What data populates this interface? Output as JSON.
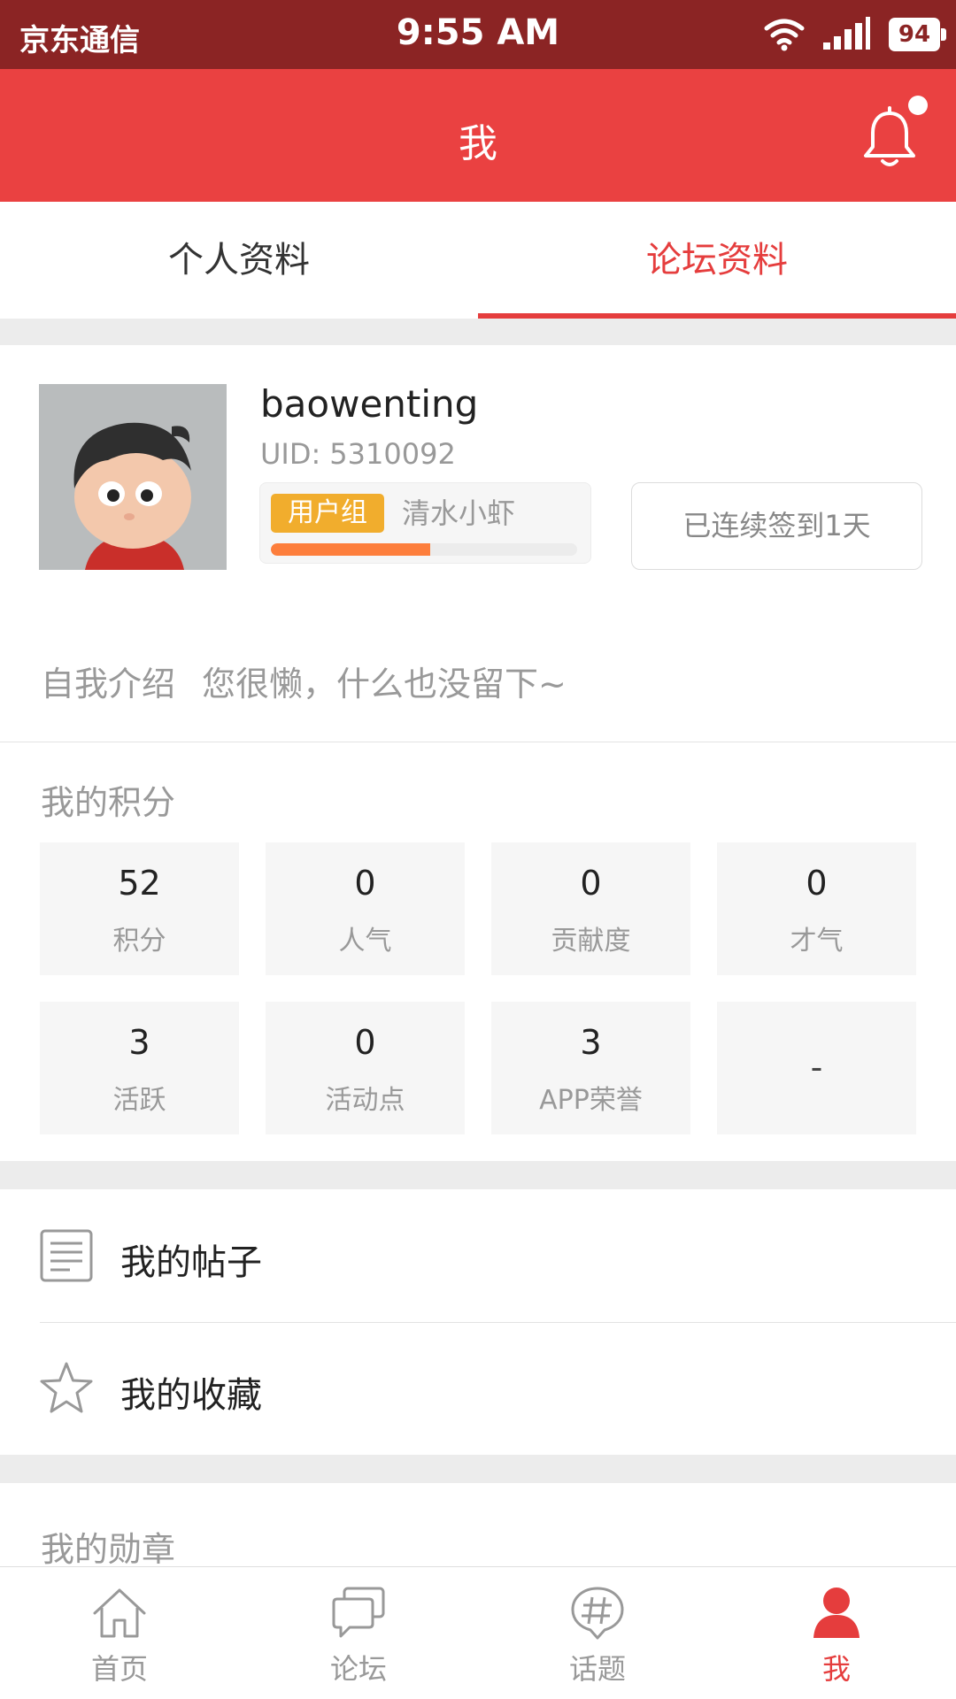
{
  "status_bar": {
    "carrier": "京东通信",
    "time": "9:55 AM",
    "battery": "94"
  },
  "header": {
    "title": "我"
  },
  "tabs": [
    {
      "label": "个人资料",
      "active": false
    },
    {
      "label": "论坛资料",
      "active": true
    }
  ],
  "profile": {
    "username": "baowenting",
    "uid_label": "UID:",
    "uid_value": "5310092",
    "group_badge": "用户组",
    "group_name": "清水小虾",
    "level_progress": 0.52,
    "checkin_label": "已连续签到1天"
  },
  "intro": {
    "label": "自我介绍",
    "value": "您很懒，什么也没留下~"
  },
  "points": {
    "title": "我的积分",
    "items": [
      {
        "value": "52",
        "label": "积分"
      },
      {
        "value": "0",
        "label": "人气"
      },
      {
        "value": "0",
        "label": "贡献度"
      },
      {
        "value": "0",
        "label": "才气"
      },
      {
        "value": "3",
        "label": "活跃"
      },
      {
        "value": "0",
        "label": "活动点"
      },
      {
        "value": "3",
        "label": "APP荣誉"
      },
      {
        "value": "-",
        "label": ""
      }
    ]
  },
  "menu": {
    "posts": {
      "label": "我的帖子",
      "icon": "document-icon"
    },
    "favorites": {
      "label": "我的收藏",
      "icon": "star-icon"
    }
  },
  "medals": {
    "title": "我的勋章"
  },
  "bottom_nav": [
    {
      "label": "首页",
      "icon": "home-icon",
      "active": false
    },
    {
      "label": "论坛",
      "icon": "chat-icon",
      "active": false
    },
    {
      "label": "话题",
      "icon": "hashtag-icon",
      "active": false
    },
    {
      "label": "我",
      "icon": "profile-icon",
      "active": true
    }
  ],
  "colors": {
    "status_bar": "#8b2424",
    "header": "#ea4141",
    "accent": "#e53d3d",
    "badge": "#f1ad2d",
    "progress": "#fd7e3c"
  }
}
